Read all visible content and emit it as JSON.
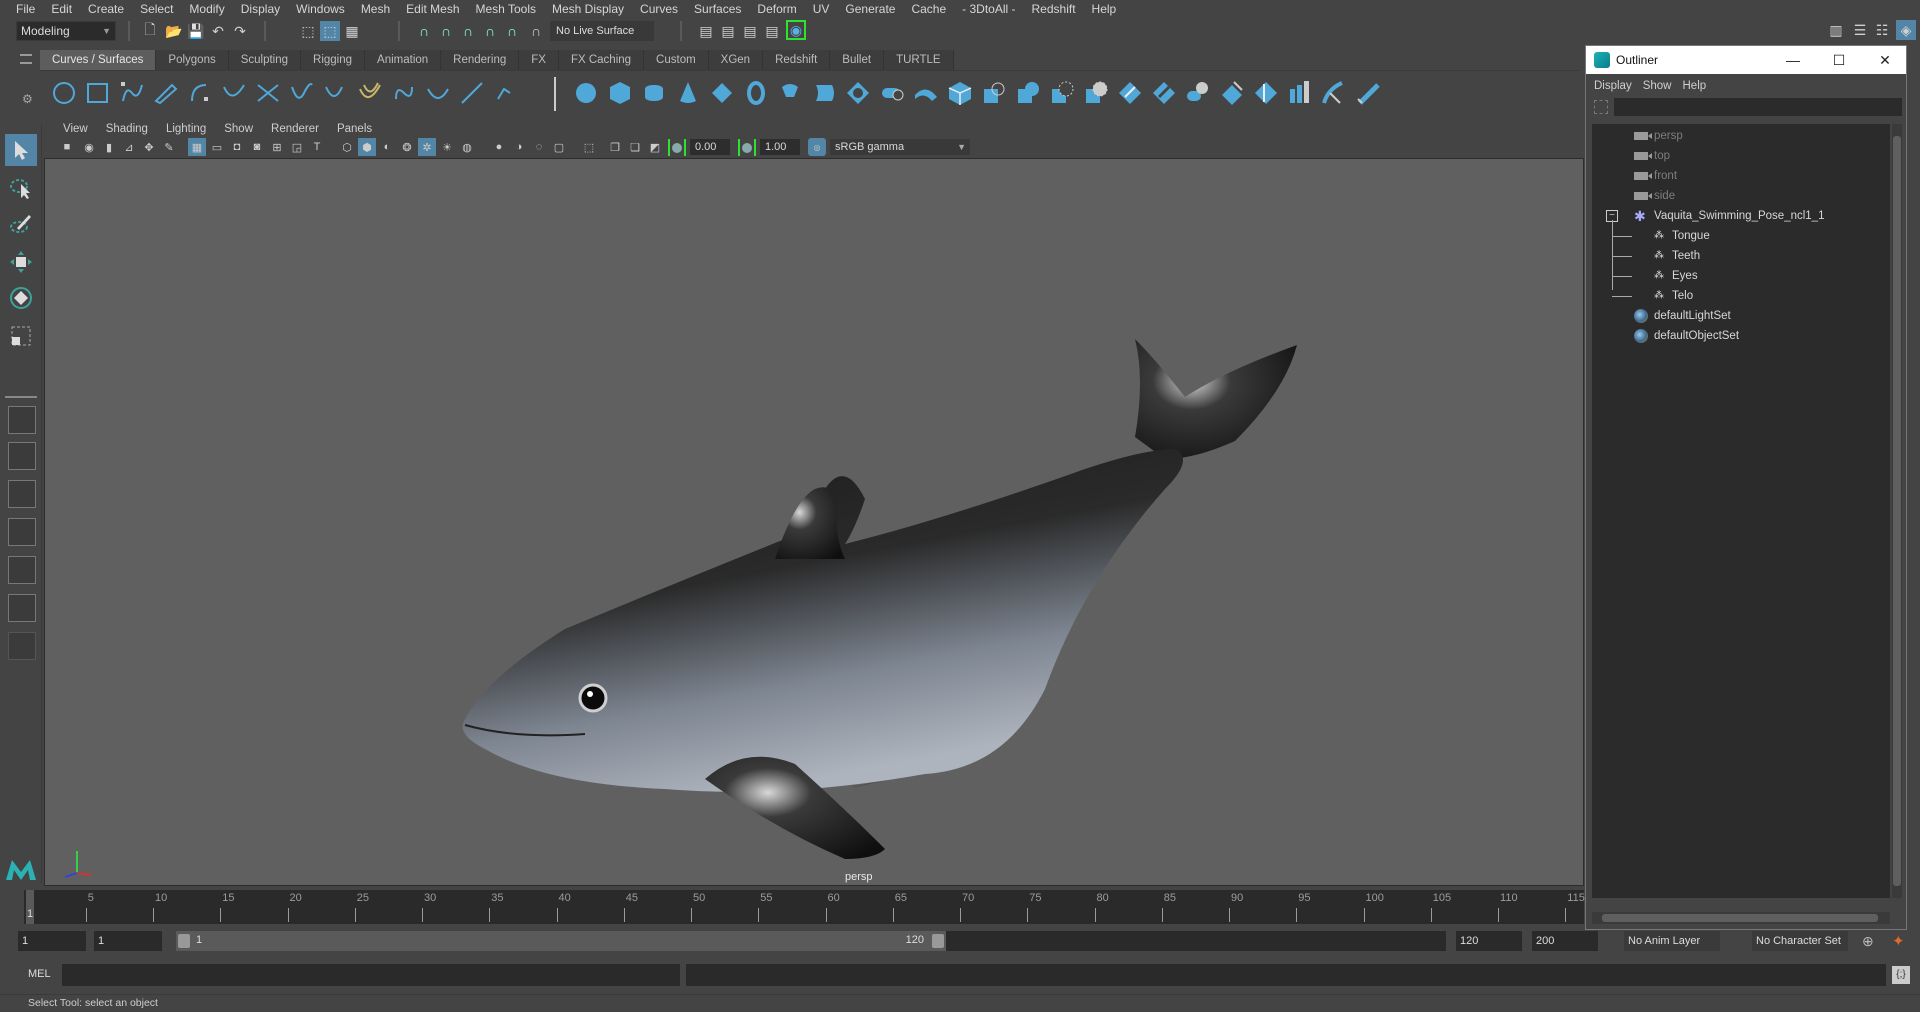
{
  "menu": [
    "File",
    "Edit",
    "Create",
    "Select",
    "Modify",
    "Display",
    "Windows",
    "Mesh",
    "Edit Mesh",
    "Mesh Tools",
    "Mesh Display",
    "Curves",
    "Surfaces",
    "Deform",
    "UV",
    "Generate",
    "Cache",
    "- 3DtoAll -",
    "Redshift",
    "Help"
  ],
  "statusline": {
    "mode": "Modeling",
    "live_surface": "No Live Surface"
  },
  "shelf": {
    "tabs": [
      "Curves / Surfaces",
      "Polygons",
      "Sculpting",
      "Rigging",
      "Animation",
      "Rendering",
      "FX",
      "FX Caching",
      "Custom",
      "XGen",
      "Redshift",
      "Bullet",
      "TURTLE"
    ],
    "active_tab": "Curves / Surfaces"
  },
  "viewport": {
    "menu": [
      "View",
      "Shading",
      "Lighting",
      "Show",
      "Renderer",
      "Panels"
    ],
    "exposure": "0.00",
    "gamma": "1.00",
    "color_space": "sRGB gamma",
    "camera_label": "persp",
    "axis": {
      "x": "x",
      "y": "y",
      "z": "z"
    }
  },
  "timeline": {
    "ticks": [
      5,
      10,
      15,
      20,
      25,
      30,
      35,
      40,
      45,
      50,
      55,
      60,
      65,
      70,
      75,
      80,
      85,
      90,
      95,
      100,
      105,
      110,
      115
    ],
    "current_frame": "1",
    "range_start_field": "1",
    "playback_start_field": "1",
    "range_slider_start": "1",
    "range_slider_end": "120",
    "playback_end_field": "120",
    "animation_end_field": "200",
    "anim_layer": "No Anim Layer",
    "character_set": "No Character Set"
  },
  "command": {
    "language": "MEL",
    "help_text": "Select Tool: select an object"
  },
  "outliner": {
    "title": "Outliner",
    "menu": [
      "Display",
      "Show",
      "Help"
    ],
    "cameras": [
      "persp",
      "top",
      "front",
      "side"
    ],
    "group": "Vaquita_Swimming_Pose_ncl1_1",
    "children": [
      "Tongue",
      "Teeth",
      "Eyes",
      "Telo"
    ],
    "sets": [
      "defaultLightSet",
      "defaultObjectSet"
    ]
  },
  "colors": {
    "accent": "#5285a6",
    "shelf_icon": "#4fa8d8",
    "viewport_bg": "#606060",
    "ui_bg": "#444444"
  }
}
